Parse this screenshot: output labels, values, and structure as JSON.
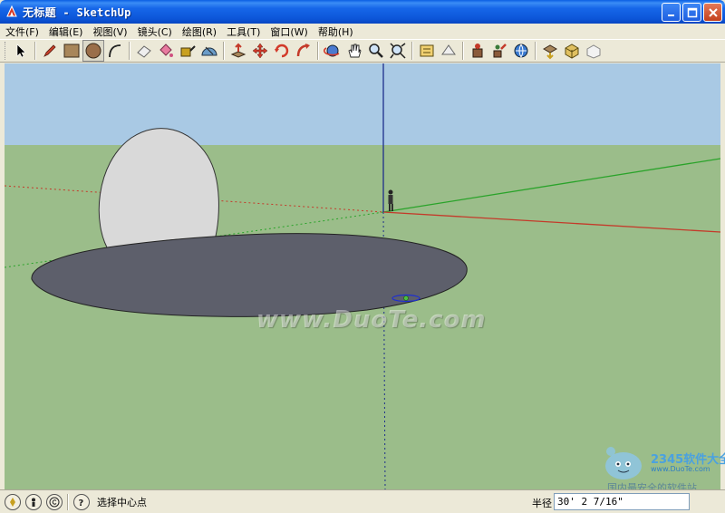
{
  "window": {
    "title": "无标题 - SketchUp"
  },
  "menu": [
    "文件(F)",
    "编辑(E)",
    "视图(V)",
    "镜头(C)",
    "绘图(R)",
    "工具(T)",
    "窗口(W)",
    "帮助(H)"
  ],
  "toolbar": {
    "tools": [
      "select-icon",
      "pencil-icon",
      "rectangle-icon",
      "circle-icon",
      "arc-icon",
      "eraser-icon",
      "paint-bucket-icon",
      "tape-measure-icon",
      "protractor-icon",
      "push-pull-icon",
      "move-icon",
      "rotate-icon",
      "follow-me-icon",
      "orbit-icon",
      "pan-icon",
      "zoom-icon",
      "zoom-extents-icon",
      "section-plane-icon",
      "walk-icon",
      "position-camera-icon",
      "look-around-icon",
      "get-models-icon",
      "share-model-icon",
      "component-icon"
    ]
  },
  "viewport": {
    "colors": {
      "sky": "#a9c9e4",
      "ground": "#9bbd8a",
      "disk": "#5d5f6b",
      "sphere": "#d9d9d9",
      "red_axis": "#c43a2a",
      "green_axis": "#2aa32a",
      "blue_axis": "#1e2f8a"
    }
  },
  "watermark": {
    "text": "www.DuoTe.com"
  },
  "logo": {
    "brand": "2345软件大全",
    "url": "www.DuoTe.com",
    "slogan": "国内最安全的软件站"
  },
  "status": {
    "hint": "选择中心点",
    "radius_label": "半径",
    "radius_value": "30' 2 7/16\""
  }
}
